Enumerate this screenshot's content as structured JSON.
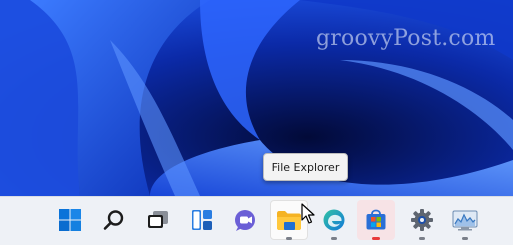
{
  "watermark": {
    "text": "groovyPost.com"
  },
  "tooltip": {
    "text": "File Explorer"
  },
  "taskbar": {
    "items": [
      {
        "name": "start",
        "icon": "windows-start-icon"
      },
      {
        "name": "search",
        "icon": "search-icon"
      },
      {
        "name": "task-view",
        "icon": "task-view-icon"
      },
      {
        "name": "widgets",
        "icon": "widgets-icon"
      },
      {
        "name": "chat",
        "icon": "teams-chat-icon"
      },
      {
        "name": "file-explorer",
        "icon": "folder-icon",
        "state": "active",
        "running": true
      },
      {
        "name": "edge",
        "icon": "edge-icon",
        "running": true
      },
      {
        "name": "store",
        "icon": "microsoft-store-icon",
        "running": true,
        "state": "hover"
      },
      {
        "name": "settings",
        "icon": "gear-icon",
        "running": true
      },
      {
        "name": "performance-monitor",
        "icon": "performance-monitor-icon",
        "running": true
      }
    ]
  },
  "colors": {
    "desktop_dark": "#061055",
    "desktop_bright": "#2f6bff",
    "taskbar": "#eef1f6",
    "accent": "#e8393b"
  }
}
